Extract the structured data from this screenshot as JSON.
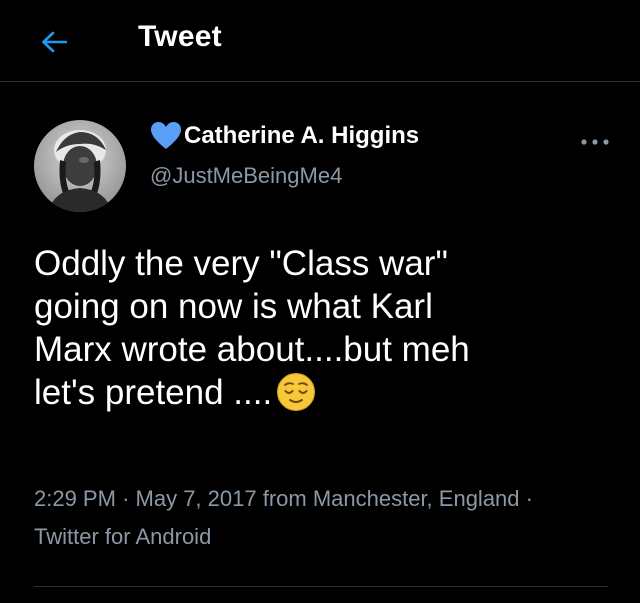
{
  "header": {
    "title": "Tweet",
    "back_icon": "arrow-left-icon",
    "accent_color": "#1d9bf0"
  },
  "author": {
    "display_name": "Catherine A. Higgins",
    "handle": "@JustMeBeingMe4",
    "name_icon": "blue-heart-icon",
    "heart_color": "#5a9ff7"
  },
  "tweet": {
    "text_line_1": "Oddly the very \"Class war\"",
    "text_line_2": "going on now is what Karl",
    "text_line_3": "Marx wrote about....but meh",
    "text_line_4": "let's pretend ....",
    "emoji": "relieved-face-emoji"
  },
  "meta": {
    "time": "2:29 PM",
    "separator": "·",
    "date": "May 7, 2017",
    "location": "from Manchester, England",
    "client": "Twitter for Android"
  },
  "more_icon": "more-horizontal-icon",
  "colors": {
    "background": "#000000",
    "text": "#ffffff",
    "secondary_text": "#8b98a5",
    "divider": "#2f3336"
  }
}
